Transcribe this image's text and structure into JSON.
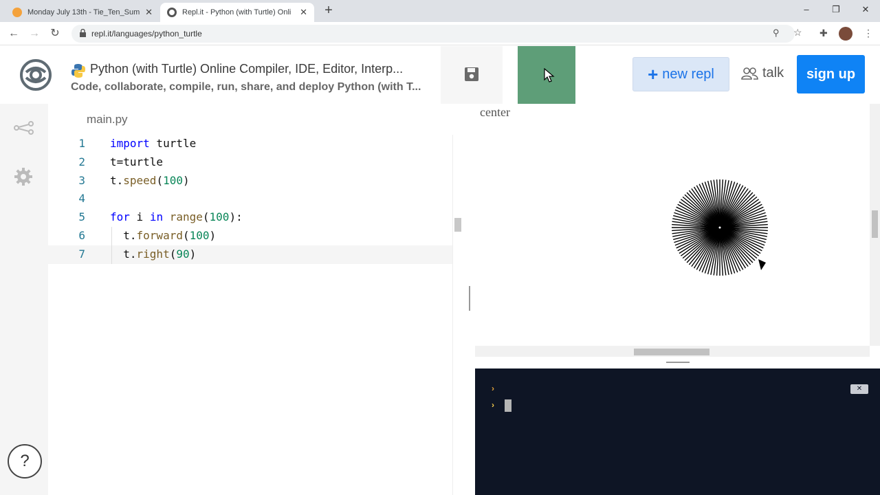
{
  "browser": {
    "tabs": [
      {
        "title": "Monday July 13th - Tie_Ten_Sum",
        "active": false,
        "favicon_color": "#f4a23c"
      },
      {
        "title": "Repl.it - Python (with Turtle) Onli",
        "active": true,
        "favicon_color": "#555555"
      }
    ],
    "url": "repl.it/languages/python_turtle",
    "win_minimize": "–",
    "win_restore": "❐",
    "win_close": "✕",
    "new_tab": "+"
  },
  "header": {
    "title": "Python (with Turtle) Online Compiler, IDE, Editor, Interp...",
    "subtitle": "Code, collaborate, compile, run, share, and deploy Python (with T...",
    "new_repl_label": "new repl",
    "new_repl_plus": "+",
    "talk_label": "talk",
    "signup_label": "sign up"
  },
  "editor": {
    "filename": "main.py",
    "lines": [
      {
        "n": "1",
        "tokens": [
          [
            "kw",
            "import"
          ],
          [
            "",
            " turtle"
          ]
        ]
      },
      {
        "n": "2",
        "tokens": [
          [
            "",
            "t=turtle"
          ]
        ]
      },
      {
        "n": "3",
        "tokens": [
          [
            "",
            "t."
          ],
          [
            "fn",
            "speed"
          ],
          [
            "",
            "("
          ],
          [
            "num",
            "100"
          ],
          [
            "",
            ")"
          ]
        ]
      },
      {
        "n": "4",
        "tokens": []
      },
      {
        "n": "5",
        "tokens": [
          [
            "kw",
            "for"
          ],
          [
            "",
            " i "
          ],
          [
            "kw",
            "in"
          ],
          [
            "",
            " "
          ],
          [
            "fn",
            "range"
          ],
          [
            "",
            "("
          ],
          [
            "num",
            "100"
          ],
          [
            "",
            "):"
          ]
        ]
      },
      {
        "n": "6",
        "tokens": [
          [
            "",
            "  t."
          ],
          [
            "fn",
            "forward"
          ],
          [
            "",
            "("
          ],
          [
            "num",
            "100"
          ],
          [
            "",
            ")"
          ]
        ]
      },
      {
        "n": "7",
        "tokens": [
          [
            "",
            "  t."
          ],
          [
            "fn",
            "right"
          ],
          [
            "",
            "("
          ],
          [
            "num",
            "90"
          ],
          [
            "",
            ")"
          ]
        ]
      }
    ],
    "current_line": "7"
  },
  "canvas": {
    "label": "center"
  },
  "console": {
    "prompt_glyph": "›",
    "clear_glyph": "✕"
  },
  "help": {
    "label": "?"
  },
  "colors": {
    "run_button": "#5e9e78",
    "signup": "#0f83f5",
    "console_bg": "#0e1525"
  }
}
